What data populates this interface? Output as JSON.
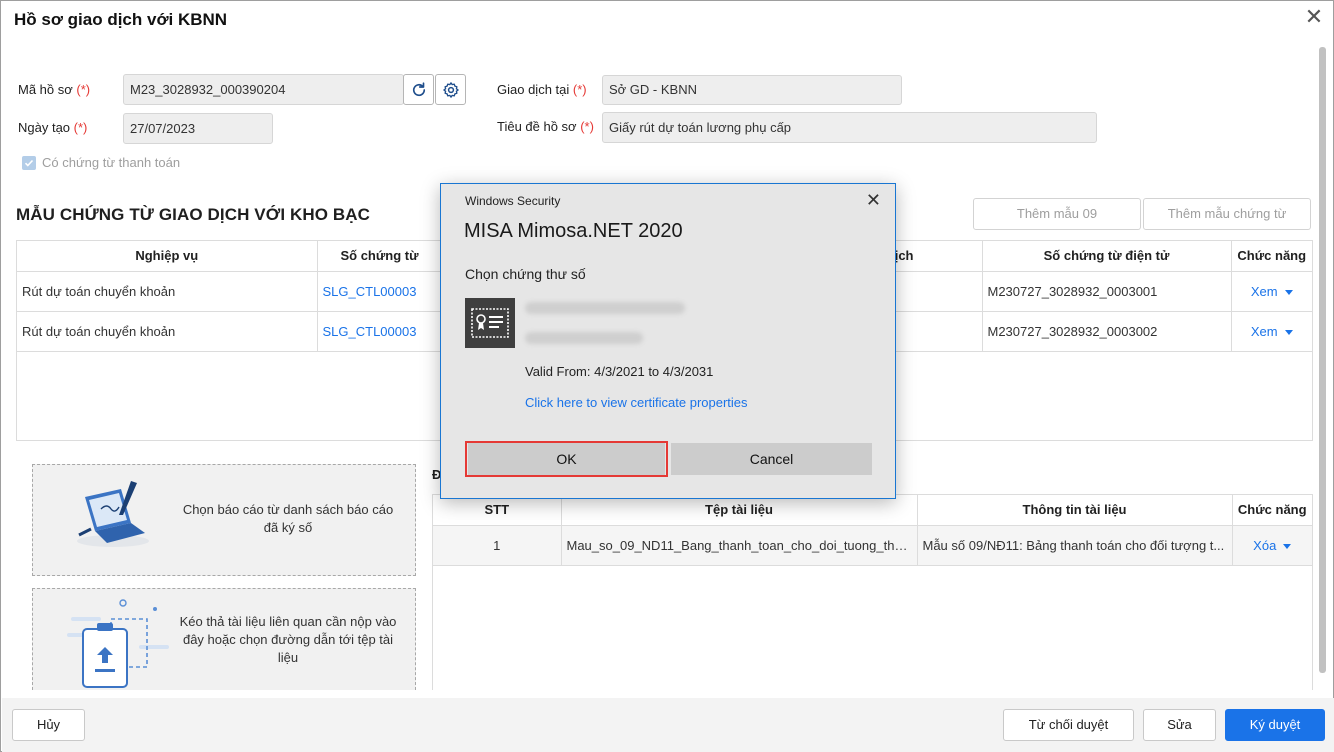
{
  "window": {
    "title": "Hồ sơ giao dịch với KBNN"
  },
  "form": {
    "ma_ho_so_label": "Mã hồ sơ",
    "ma_ho_so_value": "M23_3028932_000390204",
    "ngay_tao_label": "Ngày tạo",
    "ngay_tao_value": "27/07/2023",
    "giao_dich_tai_label": "Giao dịch tại",
    "giao_dich_tai_value": "Sở GD - KBNN",
    "tieu_de_label": "Tiêu đề hồ sơ",
    "tieu_de_value": "Giấy rút dự toán lương phụ cấp",
    "required_mark": "(*)",
    "checkbox_label": "Có chứng từ thanh toán"
  },
  "section": {
    "title": "MẪU CHỨNG TỪ GIAO DỊCH VỚI KHO BẠC",
    "btn_add_09": "Thêm mẫu 09",
    "btn_add_template": "Thêm mẫu chứng từ"
  },
  "voucher_table": {
    "headers": [
      "Nghiệp vụ",
      "Số chứng từ",
      "ịch",
      "Số chứng từ điện tử",
      "Chức năng"
    ],
    "rows": [
      {
        "nghiep_vu": "Rút dự toán chuyển khoản",
        "so_chung_tu": "SLG_CTL00003",
        "so_dien_tu": "M230727_3028932_0003001",
        "action": "Xem"
      },
      {
        "nghiep_vu": "Rút dự toán chuyển khoản",
        "so_chung_tu": "SLG_CTL00003",
        "so_dien_tu": "M230727_3028932_0003002",
        "action": "Xem"
      }
    ]
  },
  "dropzones": {
    "choose_report": "Chọn báo cáo từ danh sách báo cáo đã ký số",
    "drag_files": "Kéo thả tài liệu liên quan cần nộp vào đây hoặc chọn đường dẫn tới tệp tài liệu"
  },
  "attach_label_fragment": "Đ",
  "docs_table": {
    "headers": [
      "STT",
      "Tệp tài liệu",
      "Thông tin tài liệu",
      "Chức năng"
    ],
    "rows": [
      {
        "stt": "1",
        "file": "Mau_so_09_ND11_Bang_thanh_toan_cho_doi_tuong_thu_...",
        "info": "Mẫu số 09/NĐ11: Bảng thanh toán cho đối tượng t...",
        "action": "Xóa"
      }
    ]
  },
  "footer": {
    "cancel": "Hủy",
    "reject": "Từ chối duyệt",
    "edit": "Sửa",
    "approve": "Ký duyệt"
  },
  "modal": {
    "header": "Windows Security",
    "app_name": "MISA Mimosa.NET 2020",
    "subtitle": "Chọn chứng thư số",
    "valid": "Valid From: 4/3/2021 to 4/3/2031",
    "link": "Click here to view certificate properties",
    "ok": "OK",
    "cancel": "Cancel"
  },
  "colors": {
    "accent": "#1a73e8",
    "required": "#e53935",
    "highlight_frame": "#e53935"
  }
}
